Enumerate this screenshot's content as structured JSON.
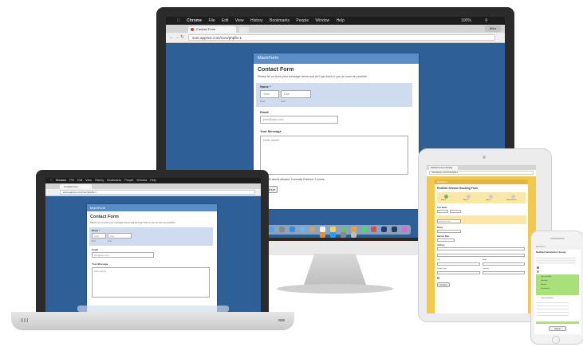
{
  "monitor": {
    "menu": [
      "Chrome",
      "File",
      "Edit",
      "View",
      "History",
      "Bookmarks",
      "People",
      "Window",
      "Help"
    ],
    "status": "100%",
    "tab_title": "Contact Form",
    "url": "sure.apprice.com/zoro/phpflo-1",
    "profile": "Mike",
    "form": {
      "header": "MachForm",
      "title": "Contact Form",
      "description": "Please let us know your message below and we'll get back to you as soon as possible.",
      "name_label": "Name *",
      "first_value": "John",
      "last_value": "Doe",
      "first_sub": "First",
      "last_sub": "Last",
      "email_label": "Email",
      "email_value": "john@doe.com",
      "message_label": "Your Message",
      "message_value": "Hello there!!",
      "counter": "Maximum of 100 words allowed.  Currently Entered: 2 words.",
      "submit": "Continue"
    }
  },
  "laptop": {
    "menu": [
      "Chrome",
      "File",
      "Edit",
      "View",
      "History",
      "Bookmarks",
      "People",
      "Window",
      "Help"
    ],
    "tab_title": "Contact Form",
    "url": "www.apprice.com/zoro/phpflo-1",
    "form": {
      "header": "MachForm",
      "title": "Contact Form",
      "description": "Please let us know your message below and we'll get back to you as soon as possible.",
      "name_label": "Name *",
      "first_value": "John",
      "last_value": "Doe",
      "first_sub": "First",
      "last_sub": "Last",
      "email_label": "Email",
      "email_value": "john@doe.com",
      "message_label": "Your Message",
      "message_value": "Hello there!!"
    }
  },
  "tablet": {
    "tab_title": "Redfield Session Booking",
    "url": "www.apprice.com/zoro/phpflo-1",
    "form": {
      "header": "MachForm",
      "title": "Redfield Session Booking Form",
      "steps": [
        "Step 1",
        "Step 2",
        "Step 3",
        "Submit Form"
      ],
      "fields": [
        "Your Name",
        "Email Address",
        "Phone",
        "Session Date",
        "Address",
        "City",
        "State",
        "Postal Code",
        "Country"
      ],
      "email_value": "john@doe.com",
      "submit": "Continue"
    }
  },
  "phone": {
    "form": {
      "header": "MachForm",
      "title": "Redfield Satisfaction Survey",
      "options": [
        "Very satisfied",
        "Satisfied",
        "Neutral",
        "Unsatisfied",
        "Very unsatisfied"
      ],
      "submit": "Submit"
    }
  },
  "colors": {
    "desktop_bg": "#2e5f96",
    "form_header": "#5b8ec7",
    "highlight": "#cfdcef",
    "tablet_accent": "#f2c94c",
    "phone_accent": "#a8e07a"
  }
}
